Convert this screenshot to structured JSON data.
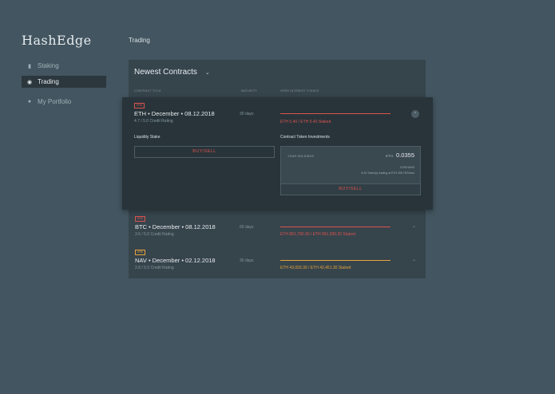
{
  "app": {
    "logo": "HashEdge",
    "page_title": "Trading"
  },
  "nav": [
    {
      "label": "Staking",
      "icon": "document-icon"
    },
    {
      "label": "Trading",
      "icon": "globe-icon",
      "active": true
    },
    {
      "label": "My Portfolio",
      "icon": "user-icon"
    }
  ],
  "card": {
    "title": "Newest Contracts",
    "columns": {
      "title": "CONTRACT TITLE",
      "maturity": "MATURITY",
      "stakes": "OPEN INTEREST STAKES"
    }
  },
  "contracts": [
    {
      "badge": "PRE",
      "title": "ETH • December • 08.12.2018",
      "rating": "4.7 / 5.0 Credit Rating",
      "maturity": "30 days",
      "stakes": "ETH 5.40 / ETH 5.40 Staked",
      "progress": 1.0,
      "color": "#d9534f",
      "expanded": true
    },
    {
      "badge": "PRE",
      "title": "BTC • December • 08.12.2018",
      "rating": "3.6 / 5.0 Credit Rating",
      "maturity": "60 days",
      "stakes": "ETH 861,790.30 / ETH 861,090.30 Staked",
      "progress": 1.0,
      "color": "#d9534f"
    },
    {
      "badge": "PRE",
      "title": "NAV • December • 02.12.2018",
      "rating": "2.8 / 5.0 Credit Rating",
      "maturity": "30 days",
      "stakes": "ETH 43,093.30 / ETH 42,451.30 Staked",
      "progress": 1.0,
      "color": "#e5a33b"
    }
  ],
  "expanded": {
    "liquidity_label": "Liquidity Stake",
    "buy_sell": "BUY/SELL",
    "contract_label": "Contract Token Investments",
    "holdings_label": "YOUR HOLDINGS",
    "holdings_unit": "ETH",
    "holdings_value": "0.0355",
    "rate": "0.003 Wh/S",
    "tokens": "5.34 Token(s) trading at ETH 205.75/Token",
    "buy_sell_2": "BUY/SELL"
  },
  "colors": {
    "bg": "#435560",
    "card": "#36444c",
    "expanded": "#28343a",
    "accent_red": "#d9534f",
    "accent_orange": "#e5a33b"
  }
}
